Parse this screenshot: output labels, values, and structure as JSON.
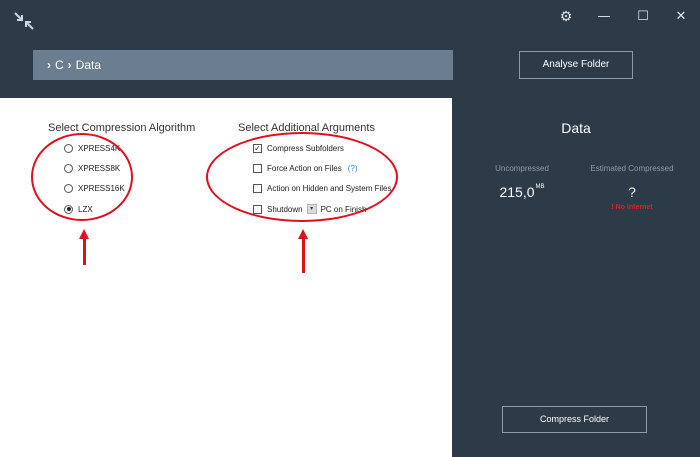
{
  "titlebar": {
    "logo_icon": "compress-arrows-icon",
    "settings_icon": "gear-icon",
    "minimize_icon": "minimize-icon",
    "maximize_icon": "maximize-icon",
    "close_icon": "close-icon",
    "settings_glyph": "⚙",
    "minimize_glyph": "—",
    "maximize_glyph": "☐",
    "close_glyph": "✕"
  },
  "path": {
    "chevron": "›",
    "segments": [
      "C",
      "Data"
    ]
  },
  "header": {
    "analyse_label": "Analyse Folder"
  },
  "algorithms": {
    "title": "Select Compression Algorithm",
    "options": [
      {
        "label": "XPRESS4K",
        "selected": false
      },
      {
        "label": "XPRESS8K",
        "selected": false
      },
      {
        "label": "XPRESS16K",
        "selected": false
      },
      {
        "label": "LZX",
        "selected": true
      }
    ]
  },
  "arguments": {
    "title": "Select Additional Arguments",
    "compress_subfolders": {
      "label": "Compress Subfolders",
      "checked": true
    },
    "force_action": {
      "label": "Force Action on Files",
      "help": "(?)",
      "checked": false
    },
    "hidden_system": {
      "label": "Action on Hidden and System Files",
      "checked": false
    },
    "shutdown": {
      "label_before": "Shutdown",
      "label_after": "PC on Finish",
      "checked": false,
      "dropdown_glyph": "▾"
    }
  },
  "summary": {
    "title": "Data",
    "uncompressed_label": "Uncompressed",
    "uncompressed_value": "215,0",
    "uncompressed_unit": "MB",
    "estimated_label": "Estimated Compressed",
    "estimated_value": "?",
    "status": "! No Internet",
    "compress_label": "Compress Folder"
  },
  "colors": {
    "annotation": "#e01020",
    "window_bg": "#2d3a48",
    "path_bar": "#6b7e8f",
    "status_error": "#e02020"
  }
}
